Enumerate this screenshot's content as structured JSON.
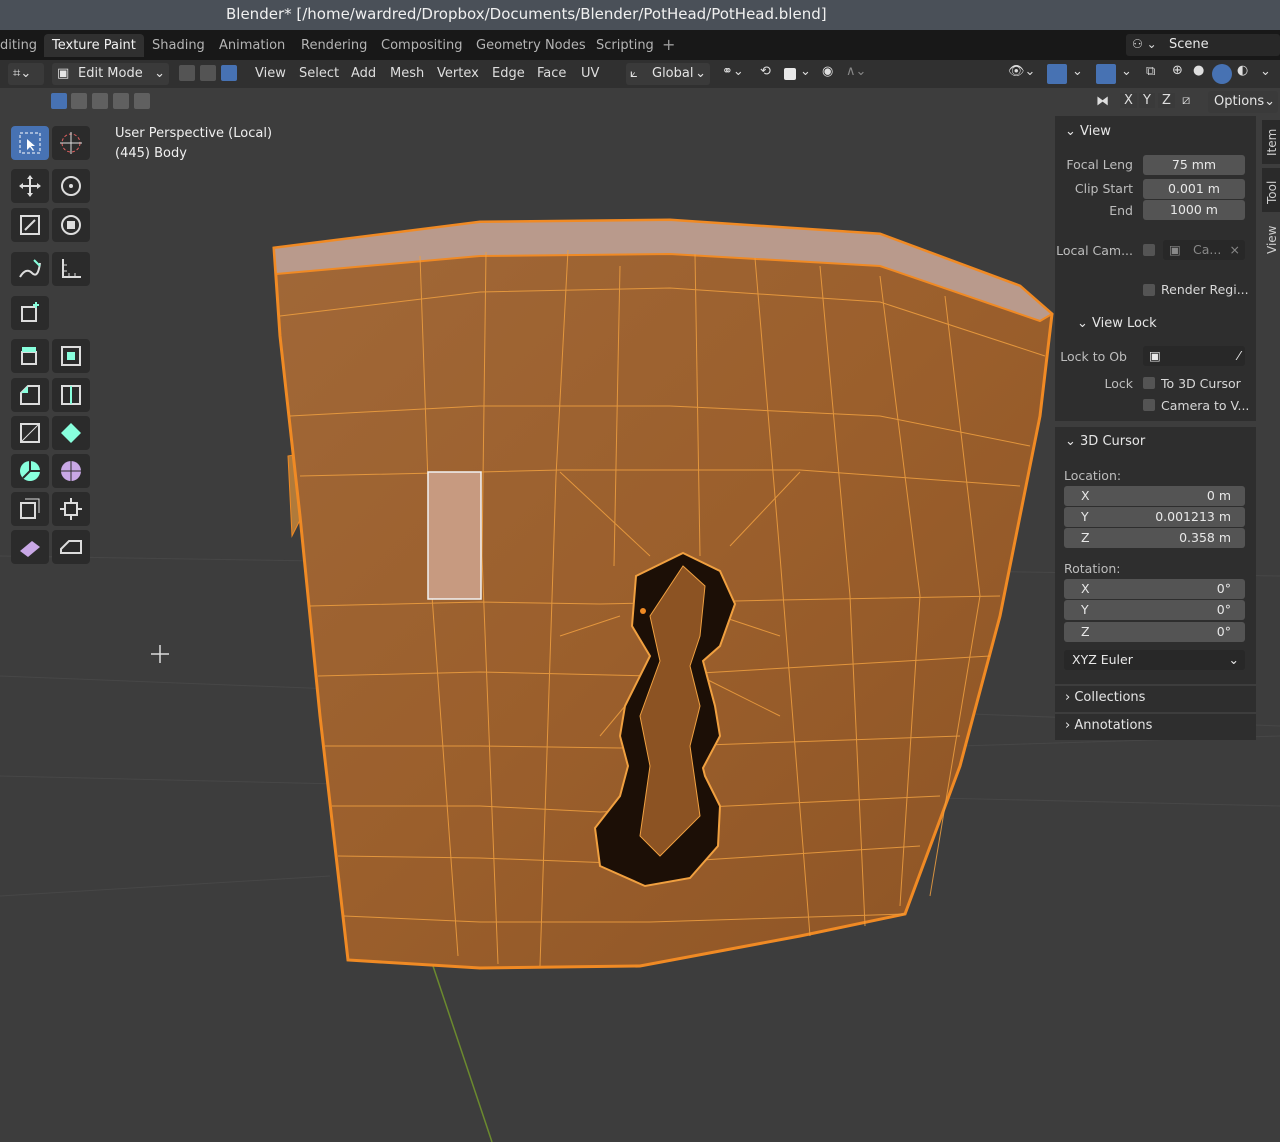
{
  "window": {
    "title": "Blender* [/home/wardred/Dropbox/Documents/Blender/PotHead/PotHead.blend]"
  },
  "workspaces": {
    "tabs": [
      {
        "label": "diting"
      },
      {
        "label": "Texture Paint"
      },
      {
        "label": "Shading"
      },
      {
        "label": "Animation"
      },
      {
        "label": "Rendering"
      },
      {
        "label": "Compositing"
      },
      {
        "label": "Geometry Nodes"
      },
      {
        "label": "Scripting"
      }
    ],
    "add": "+",
    "scene_label": "Scene"
  },
  "header": {
    "mode": "Edit Mode",
    "menus": [
      "View",
      "Select",
      "Add",
      "Mesh",
      "Vertex",
      "Edge",
      "Face",
      "UV"
    ],
    "orientation": "Global",
    "options": "Options",
    "axes": [
      "X",
      "Y",
      "Z"
    ]
  },
  "viewport": {
    "perspective": "User Perspective (Local)",
    "object": "(445) Body",
    "accent": "#f08a24",
    "active_tool_color": "#4772b3"
  },
  "npanel": {
    "tabs": [
      "Item",
      "Tool",
      "View"
    ],
    "view": {
      "title": "View",
      "focal_label": "Focal Leng",
      "focal_value": "75 mm",
      "clip_start_label": "Clip Start",
      "clip_start_value": "0.001 m",
      "end_label": "End",
      "end_value": "1000 m",
      "local_cam_label": "Local Cam...",
      "local_cam_value": "Ca...",
      "render_region": "Render Regi...",
      "view_lock_title": "View Lock",
      "lock_to_ob_label": "Lock to Ob",
      "lock_label": "Lock",
      "lock_cursor": "To 3D Cursor",
      "lock_camera": "Camera to V..."
    },
    "cursor": {
      "title": "3D Cursor",
      "location_label": "Location:",
      "loc_x_label": "X",
      "loc_x": "0 m",
      "loc_y_label": "Y",
      "loc_y": "0.001213 m",
      "loc_z_label": "Z",
      "loc_z": "0.358 m",
      "rotation_label": "Rotation:",
      "rot_x_label": "X",
      "rot_x": "0°",
      "rot_y_label": "Y",
      "rot_y": "0°",
      "rot_z_label": "Z",
      "rot_z": "0°",
      "rotation_mode": "XYZ Euler"
    },
    "collections": "Collections",
    "annotations": "Annotations"
  }
}
